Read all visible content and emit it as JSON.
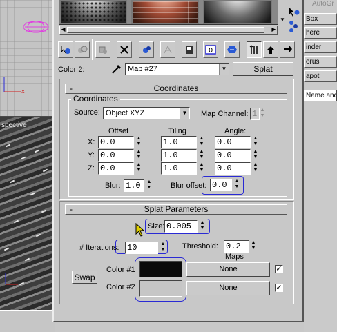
{
  "background": {
    "viewport_label": "spective",
    "right_panel": {
      "header": "AutoGr",
      "buttons": [
        "Box",
        "here",
        "inder",
        "orus",
        "apot"
      ],
      "name_field": "Name and"
    }
  },
  "toolbar": {
    "icons": [
      "get-material-icon",
      "put-material-icon",
      "assign-material-icon",
      "delete-icon",
      "copy-material-icon",
      "unique-icon",
      "put-to-library-icon",
      "material-effects-channel-icon",
      "show-map-icon",
      "show-end-result-icon",
      "go-to-parent-icon",
      "go-forward-icon"
    ]
  },
  "header": {
    "color_label": "Color 2:",
    "map_name": "Map #27",
    "map_type": "Splat"
  },
  "coordinates": {
    "rollout_title": "Coordinates",
    "minus": "-",
    "group_title": "Coordinates",
    "source_label": "Source:",
    "source_value": "Object XYZ",
    "map_channel_label": "Map Channel:",
    "map_channel_value": "1",
    "offset_header": "Offset",
    "tiling_header": "Tiling",
    "angle_header": "Angle:",
    "rows": [
      {
        "axis": "X:",
        "offset": "0.0",
        "tiling": "1.0",
        "angle": "0.0"
      },
      {
        "axis": "Y:",
        "offset": "0.0",
        "tiling": "1.0",
        "angle": "0.0"
      },
      {
        "axis": "Z:",
        "offset": "0.0",
        "tiling": "1.0",
        "angle": "0.0"
      }
    ],
    "blur_label": "Blur:",
    "blur_value": "1.0",
    "blur_offset_label": "Blur offset:",
    "blur_offset_value": "0.0"
  },
  "splat": {
    "rollout_title": "Splat Parameters",
    "minus": "-",
    "size_label": "Size:",
    "size_value": "0.005",
    "iterations_label": "# Iterations:",
    "iterations_value": "10",
    "threshold_label": "Threshold:",
    "threshold_value": "0.2",
    "maps_label": "Maps",
    "swap_label": "Swap",
    "color1_label": "Color #1",
    "color1_hex": "#0a0a0a",
    "color1_map": "None",
    "color1_checked": "✓",
    "color2_label": "Color #2",
    "color2_hex": "#c6c6c6",
    "color2_map": "None",
    "color2_checked": "✓"
  },
  "colors": {
    "highlight": "#2a2ad4",
    "panel": "#c8c8c8"
  }
}
